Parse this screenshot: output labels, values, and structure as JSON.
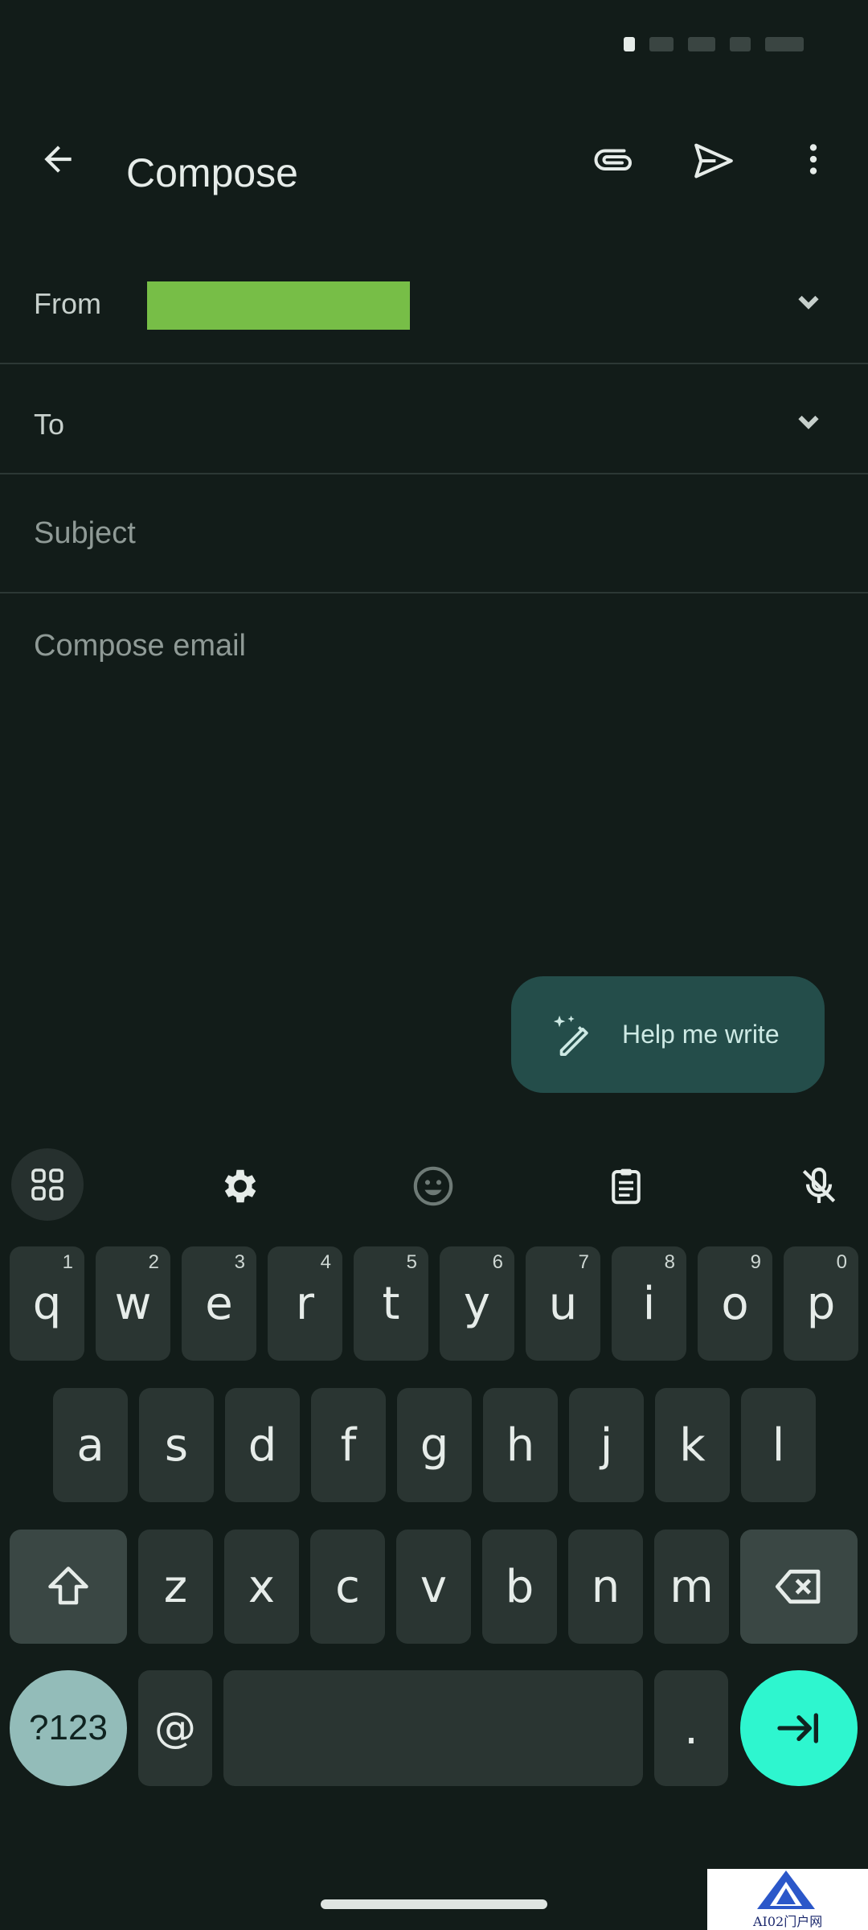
{
  "app": {
    "title": "Compose",
    "back_icon": "arrow-back-icon",
    "attach_icon": "paperclip-icon",
    "send_icon": "send-icon",
    "more_icon": "more-vert-icon"
  },
  "fields": {
    "from_label": "From",
    "to_label": "To",
    "subject_placeholder": "Subject",
    "body_placeholder": "Compose email"
  },
  "help_me_write": {
    "label": "Help me write",
    "icon": "sparkle-pen-icon"
  },
  "keyboard": {
    "toolbar": [
      "apps-grid-icon",
      "gear-icon",
      "emoji-icon",
      "clipboard-icon",
      "mic-off-icon"
    ],
    "row1": [
      {
        "key": "q",
        "hint": "1"
      },
      {
        "key": "w",
        "hint": "2"
      },
      {
        "key": "e",
        "hint": "3"
      },
      {
        "key": "r",
        "hint": "4"
      },
      {
        "key": "t",
        "hint": "5"
      },
      {
        "key": "y",
        "hint": "6"
      },
      {
        "key": "u",
        "hint": "7"
      },
      {
        "key": "i",
        "hint": "8"
      },
      {
        "key": "o",
        "hint": "9"
      },
      {
        "key": "p",
        "hint": "0"
      }
    ],
    "row2": [
      "a",
      "s",
      "d",
      "f",
      "g",
      "h",
      "j",
      "k",
      "l"
    ],
    "row3": [
      "z",
      "x",
      "c",
      "v",
      "b",
      "n",
      "m"
    ],
    "row4": {
      "symbols": "?123",
      "at": "@",
      "period": "."
    }
  },
  "watermark": {
    "text": "AI02门户网"
  },
  "colors": {
    "accent": "#2ef6cf",
    "chip": "#244d4a",
    "from_redaction": "#77be47"
  }
}
